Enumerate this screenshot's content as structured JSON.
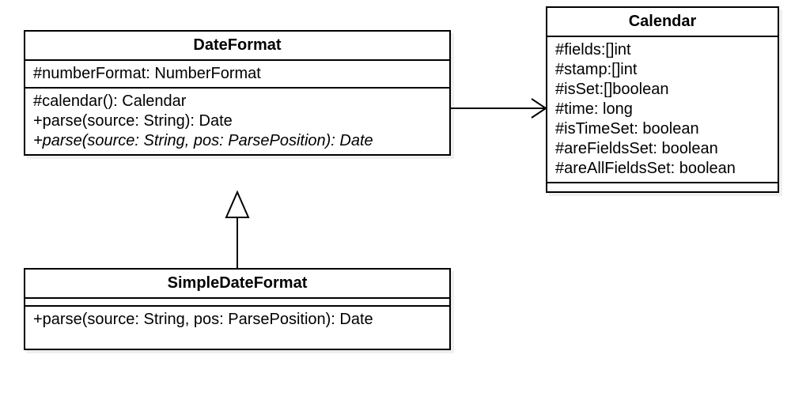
{
  "classes": {
    "dateFormat": {
      "name": "DateFormat",
      "attributes": [
        {
          "text": "#numberFormat: NumberFormat",
          "italic": false
        }
      ],
      "operations": [
        {
          "text": "#calendar(): Calendar",
          "italic": false
        },
        {
          "text": "+parse(source: String): Date",
          "italic": false
        },
        {
          "text": "+parse(source: String, pos: ParsePosition): Date",
          "italic": true
        }
      ]
    },
    "calendar": {
      "name": "Calendar",
      "attributes": [
        {
          "text": "#fields:[]int",
          "italic": false
        },
        {
          "text": "#stamp:[]int",
          "italic": false
        },
        {
          "text": "#isSet:[]boolean",
          "italic": false
        },
        {
          "text": "#time: long",
          "italic": false
        },
        {
          "text": "#isTimeSet: boolean",
          "italic": false
        },
        {
          "text": "#areFieldsSet: boolean",
          "italic": false
        },
        {
          "text": "#areAllFieldsSet: boolean",
          "italic": false
        }
      ],
      "operations": []
    },
    "simpleDateFormat": {
      "name": "SimpleDateFormat",
      "attributes": [],
      "operations": [
        {
          "text": "+parse(source: String, pos: ParsePosition): Date",
          "italic": false
        }
      ]
    }
  },
  "relationships": [
    {
      "from": "DateFormat",
      "to": "Calendar",
      "type": "association-nav"
    },
    {
      "from": "SimpleDateFormat",
      "to": "DateFormat",
      "type": "generalization"
    }
  ]
}
